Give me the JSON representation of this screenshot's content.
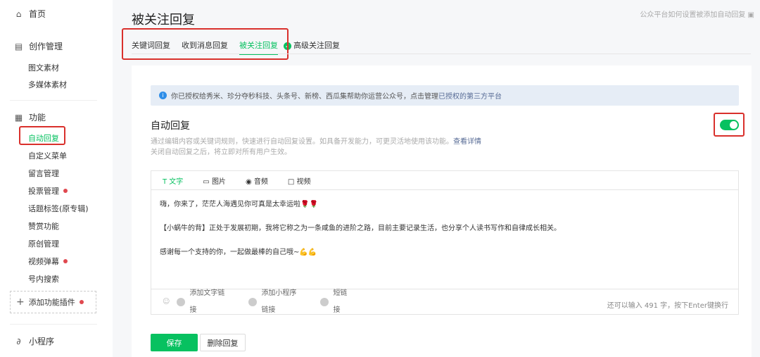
{
  "sidebar": {
    "home": "首页",
    "creation": "创作管理",
    "creation_items": [
      "图文素材",
      "多媒体素材"
    ],
    "features": "功能",
    "feature_items": [
      "自动回复",
      "自定义菜单",
      "留言管理",
      "投票管理",
      "话题标签(原专辑)",
      "赞赏功能",
      "原创管理",
      "视频弹幕",
      "号内搜索"
    ],
    "add_plugin": "添加功能插件",
    "mini_program": "小程序"
  },
  "header": {
    "title": "被关注回复",
    "help_link": "公众平台如何设置被添加自动回复"
  },
  "tabs": [
    "关键词回复",
    "收到消息回复",
    "被关注回复",
    "高级关注回复"
  ],
  "notice": {
    "text": "你已授权给秀米、珍分夺秒科技、头条号、新榜、西瓜集帮助你运营公众号，点击管理",
    "link": "已授权的第三方平台"
  },
  "section": {
    "title": "自动回复",
    "desc1": "通过编辑内容或关键词规则，快速进行自动回复设置。如具备开发能力，可更灵活地使用该功能。",
    "desc_link": "查看详情",
    "desc2": "关闭自动回复之后，将立即对所有用户生效。",
    "enabled": true
  },
  "editor": {
    "tabs": [
      "文字",
      "图片",
      "音频",
      "视频"
    ],
    "lines": [
      "嗨，你来了，茫茫人海遇见你可真是太幸运啦🌹🌹",
      "【小蜗牛的背】正处于发展初期，我将它称之为一条咸鱼的进阶之路，目前主要记录生活，也分享个人读书写作和自律成长相关。",
      "感谢每一个支持的你，一起做最棒的自己哦~💪💪"
    ],
    "links": [
      "添加文字链接",
      "添加小程序链接",
      "短链接"
    ],
    "remaining": "还可以输入 491 字，按下Enter键换行"
  },
  "buttons": {
    "save": "保存",
    "delete": "删除回复"
  }
}
